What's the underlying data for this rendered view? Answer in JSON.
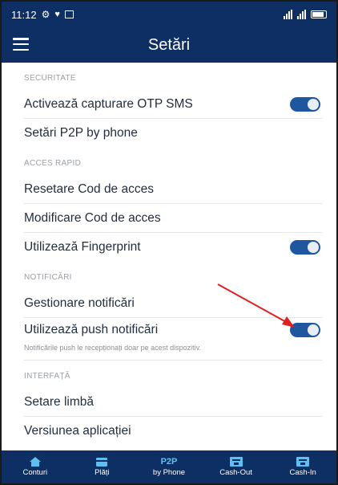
{
  "status_bar": {
    "time": "11:12"
  },
  "app_bar": {
    "title": "Setări",
    "menu_icon": "hamburger-menu-icon"
  },
  "sections": {
    "security": {
      "header": "SECURITATE",
      "otp_sms": {
        "label": "Activează capturare OTP SMS",
        "enabled": true
      },
      "p2p": {
        "label": "Setări P2P by phone"
      }
    },
    "quick_access": {
      "header": "ACCES RAPID",
      "reset_code": {
        "label": "Resetare Cod de acces"
      },
      "change_code": {
        "label": "Modificare Cod de acces"
      },
      "fingerprint": {
        "label": "Utilizează Fingerprint",
        "enabled": true
      }
    },
    "notifications": {
      "header": "NOTIFICĂRI",
      "manage": {
        "label": "Gestionare notificări"
      },
      "push": {
        "label": "Utilizează push notificări",
        "enabled": true,
        "note": "Notificările push le recepționați doar pe acest dispozitiv."
      }
    },
    "interface": {
      "header": "INTERFAȚĂ",
      "language": {
        "label": "Setare limbă"
      },
      "version": {
        "label": "Versiunea aplicației"
      }
    }
  },
  "bottom_nav": {
    "accounts": {
      "label": "Conturi",
      "icon": "home-icon"
    },
    "payments": {
      "label": "Plăți",
      "icon": "card-icon"
    },
    "p2p": {
      "label": "by Phone",
      "icon_text": "P2P"
    },
    "cash_out": {
      "label": "Cash-Out",
      "icon": "atm-icon"
    },
    "cash_in": {
      "label": "Cash-In",
      "icon": "atm-icon"
    }
  },
  "colors": {
    "primary": "#0d2f63",
    "toggle": "#1e56a0",
    "annotation_arrow": "#e02020",
    "nav_icon": "#5ec0f0"
  }
}
